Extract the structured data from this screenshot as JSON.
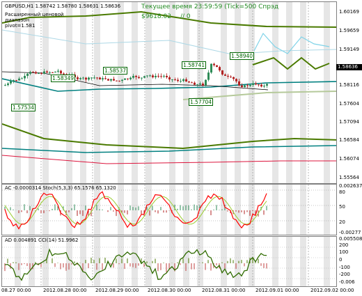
{
  "header": {
    "symbol_line": "GBPUSD,H1  1.58742 1.58780 1.58631 1.58636",
    "server_time": "Текущее время 23:59:59 (Tick=500 Спрэд",
    "balance": "$9618.02",
    "zero": "// 0",
    "range_label_1": "Расширенный ценовой",
    "range_label_2": "диапазон",
    "pivot": "pivot=1.581"
  },
  "price_axis": [
    "1.60169",
    "1.59659",
    "1.59149",
    "1.58636",
    "1.58116",
    "1.57604",
    "1.57094",
    "1.56584",
    "1.56074",
    "1.55564"
  ],
  "current_price": "1.58636",
  "price_labels": [
    "1.57534",
    "1.58349",
    "1.58537",
    "1.58741",
    "1.57704",
    "1.58940"
  ],
  "stoch": {
    "label": "AC -0.0000314   Stoch(5,3,3) 65.1576 65.1320",
    "axis": [
      "0.002637",
      "80",
      "50",
      "20",
      "-0.00277"
    ]
  },
  "ad": {
    "label": "AD 0.004891   CCI(14) 51.9962",
    "axis": [
      "0.005508",
      "200",
      "100",
      "0",
      "-100",
      "-200",
      "-0.006"
    ]
  },
  "time_axis": [
    "08.27 00:00",
    "2012.08.28 00:00",
    "2012.08.29 00:00",
    "2012.08.30 00:00",
    "2012.08.31 00:00",
    "2012.09.01 00:00",
    "2012.09.02 00:00"
  ],
  "colors": {
    "bull": "#2e8b57",
    "bear": "#b22222",
    "ma_green": "#4a7a00",
    "teal": "#008080",
    "stoch_main": "#ff0000",
    "stoch_signal": "#9acd32"
  }
}
